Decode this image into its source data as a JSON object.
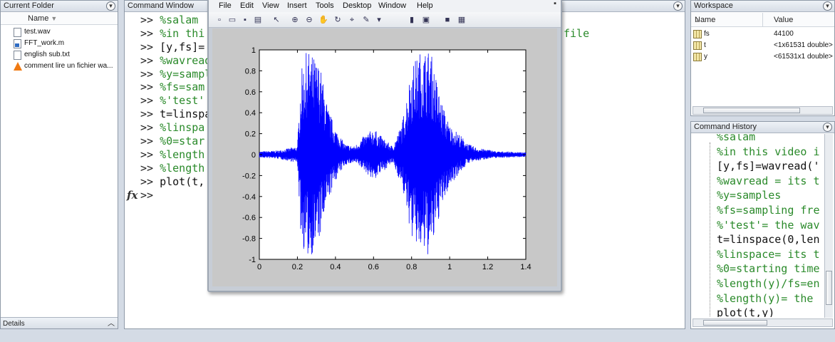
{
  "current_folder": {
    "title": "Current Folder",
    "column_name": "Name",
    "files": [
      {
        "name": "test.wav",
        "icon": "document-icon"
      },
      {
        "name": "FFT_work.m",
        "icon": "matlab-file-icon"
      },
      {
        "name": "english sub.txt",
        "icon": "document-icon"
      },
      {
        "name": "comment lire un fichier wa...",
        "icon": "vlc-icon"
      }
    ],
    "details_label": "Details"
  },
  "command_window": {
    "title": "Command Window",
    "lines": [
      {
        "prompt": ">>",
        "text": "%salam",
        "kind": "comment"
      },
      {
        "prompt": ">>",
        "text": "%in thi",
        "kind": "comment"
      },
      {
        "prompt": ">>",
        "text": "[y,fs]=",
        "kind": "code"
      },
      {
        "prompt": ">>",
        "text": "%wavread",
        "kind": "comment"
      },
      {
        "prompt": ">>",
        "text": "%y=sampl",
        "kind": "comment"
      },
      {
        "prompt": ">>",
        "text": "%fs=sam",
        "kind": "comment"
      },
      {
        "prompt": ">>",
        "text": "%'test'",
        "kind": "comment"
      },
      {
        "prompt": ">>",
        "text": "t=linspa",
        "kind": "code"
      },
      {
        "prompt": ">>",
        "text": "%linspa",
        "kind": "comment"
      },
      {
        "prompt": ">>",
        "text": "%0=star",
        "kind": "comment"
      },
      {
        "prompt": ">>",
        "text": "%length",
        "kind": "comment"
      },
      {
        "prompt": ">>",
        "text": "%length",
        "kind": "comment"
      },
      {
        "prompt": ">>",
        "text": "plot(t,",
        "kind": "code"
      },
      {
        "prompt": ">>",
        "text": "",
        "kind": "code"
      }
    ],
    "overflow_text": "file"
  },
  "workspace": {
    "title": "Workspace",
    "col_name": "Name",
    "col_value": "Value",
    "vars": [
      {
        "name": "fs",
        "value": "44100"
      },
      {
        "name": "t",
        "value": "<1x61531 double>"
      },
      {
        "name": "y",
        "value": "<61531x1 double>"
      }
    ]
  },
  "command_history": {
    "title": "Command History",
    "lines": [
      {
        "text": "%salam",
        "kind": "comment"
      },
      {
        "text": "%in this video i",
        "kind": "comment"
      },
      {
        "text": "[y,fs]=wavread('",
        "kind": "code"
      },
      {
        "text": "%wavread = its t",
        "kind": "comment"
      },
      {
        "text": "%y=samples",
        "kind": "comment"
      },
      {
        "text": "%fs=sampling fre",
        "kind": "comment"
      },
      {
        "text": "%'test'= the wav",
        "kind": "comment"
      },
      {
        "text": "t=linspace(0,len",
        "kind": "code"
      },
      {
        "text": "%linspace= its t",
        "kind": "comment"
      },
      {
        "text": "%0=starting time",
        "kind": "comment"
      },
      {
        "text": "%length(y)/fs=en",
        "kind": "comment"
      },
      {
        "text": "%length(y)= the",
        "kind": "comment"
      },
      {
        "text": "plot(t,y)",
        "kind": "code"
      }
    ]
  },
  "figure": {
    "menu": [
      "File",
      "Edit",
      "View",
      "Insert",
      "Tools",
      "Desktop",
      "Window",
      "Help"
    ],
    "toolbar_icons": [
      "new-file-icon",
      "open-icon",
      "save-icon",
      "print-icon",
      "pointer-icon",
      "zoom-in-icon",
      "zoom-out-icon",
      "pan-icon",
      "rotate-icon",
      "data-cursor-icon",
      "brush-icon",
      "link-icon",
      "colorbar-icon",
      "legend-icon",
      "plot-tools-hide-icon",
      "plot-tools-show-icon"
    ]
  },
  "chart_data": {
    "type": "line",
    "title": "",
    "xlabel": "",
    "ylabel": "",
    "xlim": [
      0,
      1.4
    ],
    "ylim": [
      -1,
      1
    ],
    "xticks": [
      "0",
      "0.2",
      "0.4",
      "0.6",
      "0.8",
      "1",
      "1.2",
      "1.4"
    ],
    "yticks": [
      "-1",
      "-0.8",
      "-0.6",
      "-0.4",
      "-0.2",
      "0",
      "0.2",
      "0.4",
      "0.6",
      "0.8",
      "1"
    ],
    "grid": false,
    "color": "#0000ff",
    "series": [
      {
        "envelope_x": [
          0,
          0.1,
          0.2,
          0.22,
          0.25,
          0.28,
          0.32,
          0.36,
          0.4,
          0.45,
          0.5,
          0.55,
          0.6,
          0.65,
          0.7,
          0.75,
          0.8,
          0.85,
          0.9,
          0.95,
          1.0,
          1.05,
          1.1,
          1.15,
          1.2,
          1.25,
          1.3,
          1.4
        ],
        "envelope_upper": [
          0.03,
          0.04,
          0.08,
          0.8,
          1.0,
          0.95,
          0.85,
          0.45,
          0.25,
          0.1,
          0.08,
          0.18,
          0.25,
          0.16,
          0.08,
          0.3,
          0.85,
          1.0,
          1.0,
          0.55,
          0.28,
          0.2,
          0.1,
          0.06,
          0.05,
          0.03,
          0.03,
          0.02
        ],
        "envelope_lower": [
          -0.03,
          -0.04,
          -0.08,
          -0.85,
          -1.0,
          -0.95,
          -0.8,
          -0.45,
          -0.25,
          -0.1,
          -0.08,
          -0.15,
          -0.25,
          -0.16,
          -0.08,
          -0.3,
          -0.8,
          -0.95,
          -0.98,
          -0.55,
          -0.3,
          -0.18,
          -0.08,
          -0.06,
          -0.04,
          -0.03,
          -0.03,
          -0.02
        ]
      }
    ]
  }
}
